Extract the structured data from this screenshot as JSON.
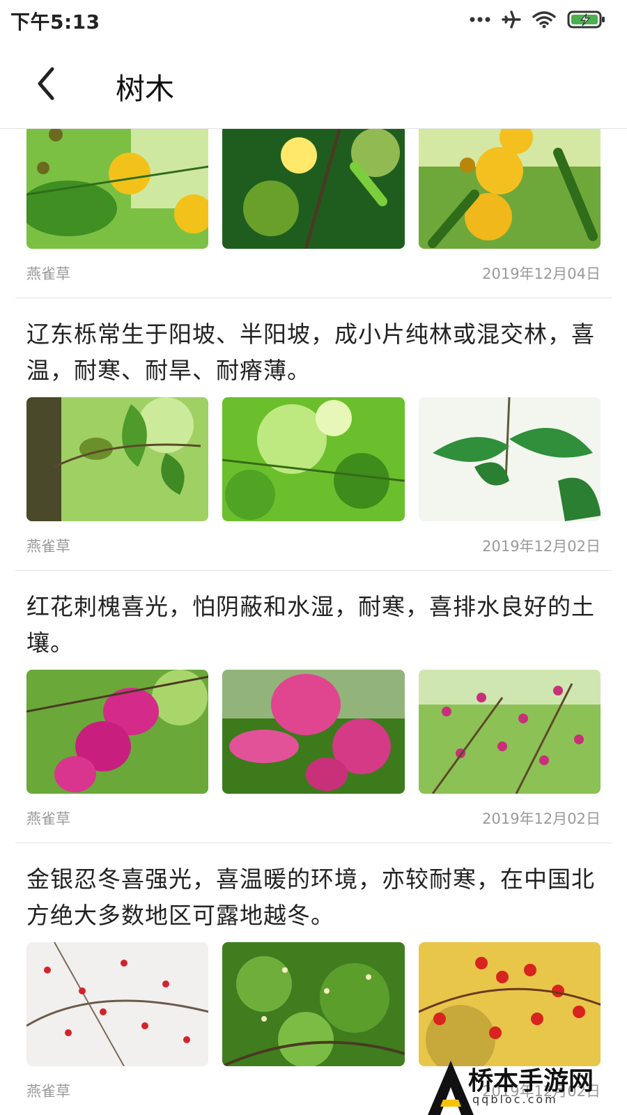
{
  "status_bar": {
    "time": "下午5:13",
    "icons": [
      "more-dots-icon",
      "airplane-icon",
      "wifi-icon",
      "battery-charging-icon"
    ],
    "battery_color": "#4caf50"
  },
  "header": {
    "back_icon": "chevron-left-icon",
    "title": "树木"
  },
  "posts": [
    {
      "text": "",
      "images": [
        "yellow-mimosa-flowers",
        "yellow-flower-branch",
        "yellow-pompom-flowers"
      ],
      "author": "燕雀草",
      "date": "2019年12月04日"
    },
    {
      "text": "辽东栎常生于阳坡、半阳坡，成小片纯林或混交林，喜温，耐寒、耐旱、耐瘠薄。",
      "images": [
        "oak-leaves-acorn",
        "green-foliage",
        "oak-leaf-branch"
      ],
      "author": "燕雀草",
      "date": "2019年12月02日"
    },
    {
      "text": "红花刺槐喜光，怕阴蔽和水湿，耐寒，喜排水良好的土壤。",
      "images": [
        "pink-locust-cluster",
        "pink-locust-closeup",
        "pink-locust-tree"
      ],
      "author": "燕雀草",
      "date": "2019年12月02日"
    },
    {
      "text": "金银忍冬喜强光，喜温暖的环境，亦较耐寒，在中国北方绝大多数地区可露地越冬。",
      "images": [
        "red-berries-snow",
        "honeysuckle-bush",
        "red-berries-yellow-leaves"
      ],
      "author": "燕雀草",
      "date": "2019年12月02日"
    }
  ],
  "watermark": {
    "title": "桥本手游网",
    "subtitle": "qqbloc.com"
  }
}
